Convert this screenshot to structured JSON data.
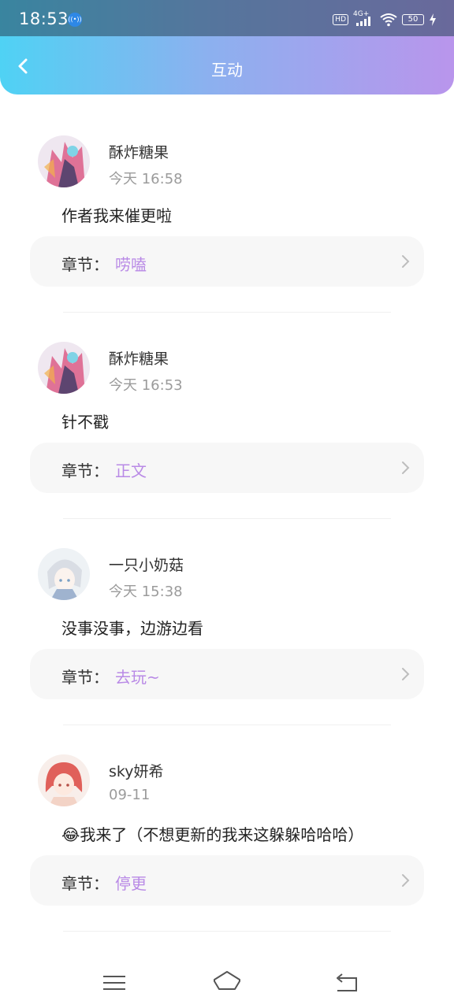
{
  "status_bar": {
    "time": "18:53",
    "hd": "HD",
    "network": "4G+",
    "battery": "50"
  },
  "header": {
    "title": "互动"
  },
  "items": [
    {
      "user": "酥炸糖果",
      "time": "今天 16:58",
      "text": "作者我来催更啦",
      "chapter_label": "章节：",
      "chapter_value": "唠嗑"
    },
    {
      "user": "酥炸糖果",
      "time": "今天 16:53",
      "text": "针不戳",
      "chapter_label": "章节：",
      "chapter_value": "正文"
    },
    {
      "user": "一只小奶菇",
      "time": "今天 15:38",
      "text": "没事没事，边游边看",
      "chapter_label": "章节：",
      "chapter_value": "去玩~"
    },
    {
      "user": "sky妍希",
      "time": "09-11",
      "text": "😂我来了（不想更新的我来这躲躲哈哈哈）",
      "chapter_label": "章节：",
      "chapter_value": "停更"
    }
  ],
  "colors": {
    "accent": "#b98ae6",
    "header_gradient_start": "#4fd2f4",
    "header_gradient_end": "#b995ec"
  },
  "icons": {
    "back": "chevron-left-icon",
    "chapter_arrow": "chevron-right-icon",
    "nav_menu": "menu-icon",
    "nav_home": "home-icon",
    "nav_back": "return-icon"
  }
}
